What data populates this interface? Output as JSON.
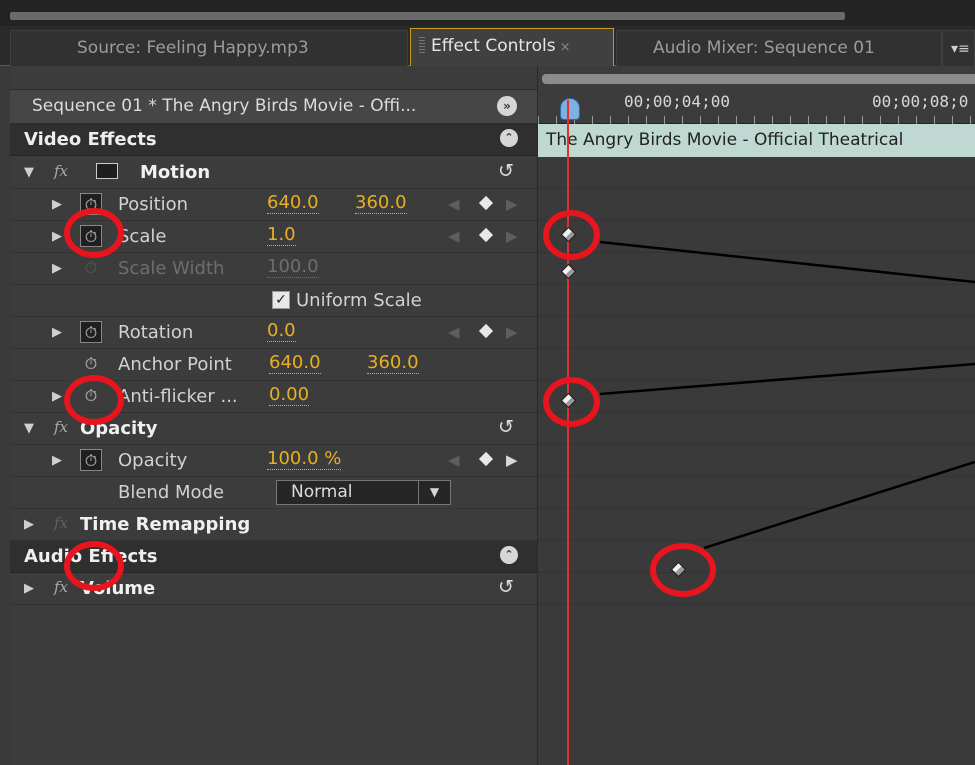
{
  "tabs": {
    "source": "Source: Feeling Happy.mp3",
    "effect_controls": "Effect Controls",
    "audio_mixer": "Audio Mixer: Sequence 01",
    "close": "×",
    "menu": "▾≡"
  },
  "sequence_title": "Sequence 01 * The Angry Birds Movie - Offi...",
  "sections": {
    "video": "Video Effects",
    "audio": "Audio Effects"
  },
  "motion": {
    "label": "Motion",
    "position": {
      "label": "Position",
      "x": "640.0",
      "y": "360.0"
    },
    "scale": {
      "label": "Scale",
      "value": "1.0"
    },
    "scale_width": {
      "label": "Scale Width",
      "value": "100.0"
    },
    "uniform_scale": {
      "label": "Uniform Scale",
      "checked": true
    },
    "rotation": {
      "label": "Rotation",
      "value": "0.0"
    },
    "anchor_point": {
      "label": "Anchor Point",
      "x": "640.0",
      "y": "360.0"
    },
    "anti_flicker": {
      "label": "Anti-flicker ...",
      "value": "0.00"
    }
  },
  "opacity": {
    "label": "Opacity",
    "prop_label": "Opacity",
    "value": "100.0 %",
    "blend_label": "Blend Mode",
    "blend_value": "Normal"
  },
  "time_remapping": "Time Remapping",
  "volume": "Volume",
  "timeline": {
    "tc1": "00;00;04;00",
    "tc2": "00;00;08;0",
    "clip": "The Angry Birds Movie - Official Theatrical"
  },
  "colors": {
    "accent": "#e8b020",
    "highlight": "#e8141e",
    "clip": "#bfd9d2"
  },
  "icons": [
    "stopwatch-icon",
    "keyframe-icon",
    "reset-icon",
    "fx-icon",
    "disclosure-triangle-icon"
  ]
}
